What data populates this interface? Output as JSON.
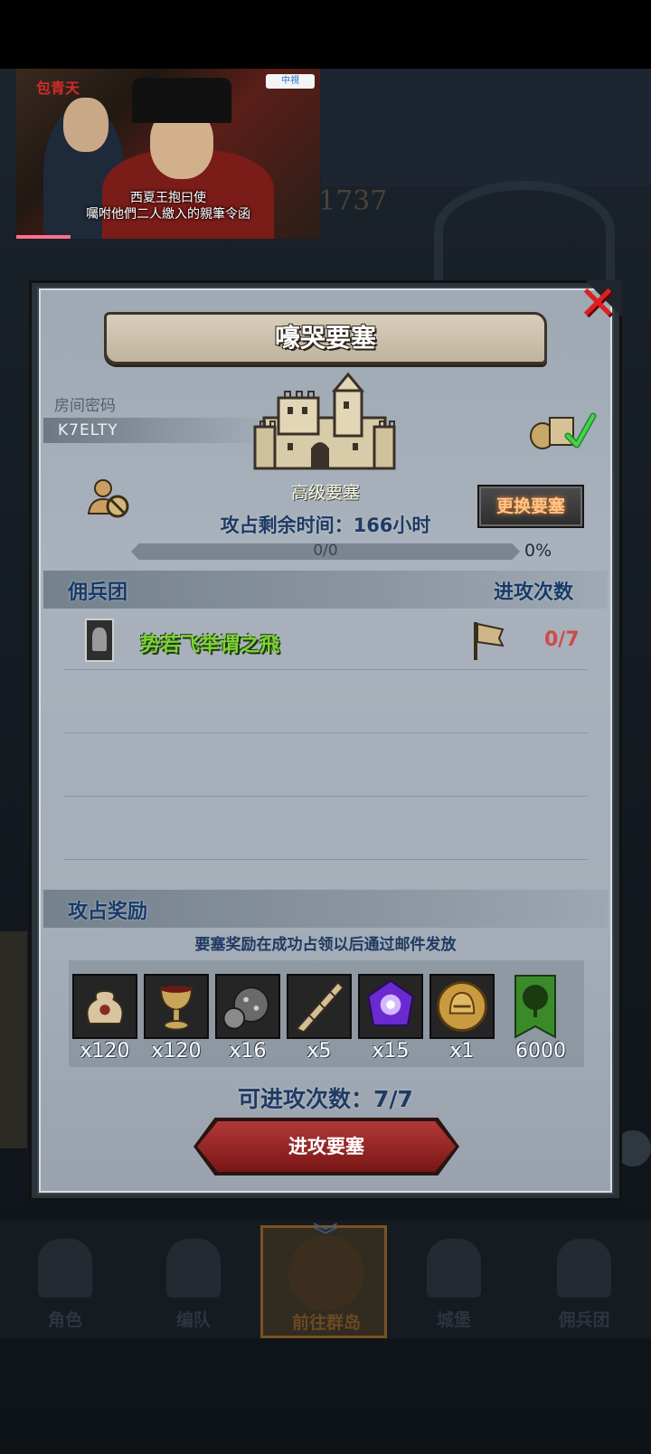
{
  "video": {
    "channel": "包青天",
    "logo_text": "中視",
    "subtitle_line1": "西夏王抱曰使",
    "subtitle_line2": "囑咐他們二人繳入的親筆令函",
    "progress": 0.18
  },
  "background": {
    "number": "1737"
  },
  "dialog": {
    "title": "嚎哭要塞",
    "close_icon": "close-icon",
    "room": {
      "label": "房间密码",
      "code": "K7ELTY"
    },
    "fortress": {
      "name": "高级要塞",
      "icon": "castle-icon"
    },
    "change_button": "更换要塞",
    "time_remaining": "攻占剩余时间：166小时",
    "progress": {
      "text": "0/0",
      "percent_text": "0%",
      "fraction": 0
    },
    "mercs_section": {
      "title": "佣兵团",
      "attacks_header": "进攻次数"
    },
    "mercs": [
      {
        "name": "势若飞举谓之飛",
        "count": "0/7"
      }
    ],
    "reward_section": {
      "title": "攻占奖励",
      "note": "要塞奖励在成功占领以后通过邮件发放"
    },
    "rewards": [
      {
        "icon": "sack-icon",
        "qty": "x120"
      },
      {
        "icon": "goblet-icon",
        "qty": "x120"
      },
      {
        "icon": "ore-icon",
        "qty": "x16"
      },
      {
        "icon": "horn-icon",
        "qty": "x5"
      },
      {
        "icon": "purple-gem-icon",
        "qty": "x15"
      },
      {
        "icon": "helmet-coin-icon",
        "qty": "x1"
      },
      {
        "icon": "tree-banner-icon",
        "qty": "6000"
      }
    ],
    "attack_count": "可进攻次数：7/7",
    "attack_button": "进攻要塞"
  },
  "nav": {
    "items": [
      {
        "label": "角色",
        "icon": "knight-icon"
      },
      {
        "label": "编队",
        "icon": "helmet-icon"
      },
      {
        "label": "前往群岛",
        "icon": "compass-icon"
      },
      {
        "label": "城堡",
        "icon": "castle-icon"
      },
      {
        "label": "佣兵团",
        "icon": "ship-icon"
      }
    ],
    "active_index": 2
  },
  "colors": {
    "title_blue": "#1f3a63",
    "merc_green": "#7ed23a",
    "count_red": "#d04a4a",
    "close_red": "#e02020",
    "button_red": "#b23838"
  }
}
